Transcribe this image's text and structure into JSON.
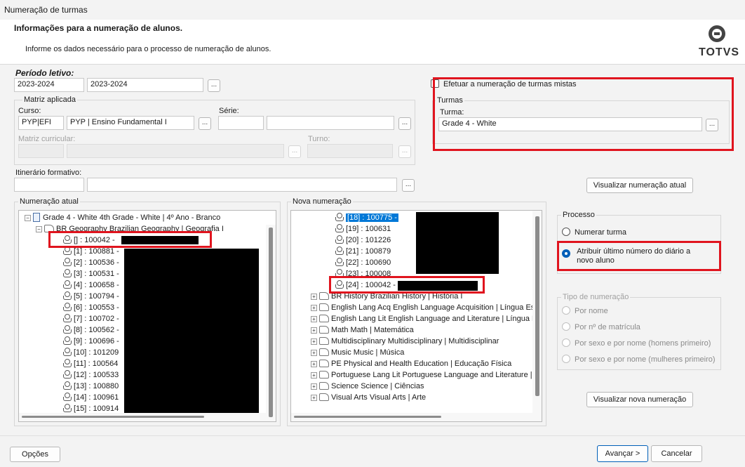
{
  "window": {
    "title": "Numeração de turmas"
  },
  "header": {
    "title": "Informações para a numeração de alunos.",
    "description": "Informe os dados necessário para o processo de numeração de alunos.",
    "logo_text": "TOTVS"
  },
  "periodo": {
    "label": "Período letivo:",
    "code": "2023-2024",
    "name": "2023-2024"
  },
  "matriz": {
    "group_title": "Matriz aplicada",
    "curso_label": "Curso:",
    "curso_code": "PYP|EFI",
    "curso_name": "PYP | Ensino Fundamental I",
    "serie_label": "Série:",
    "serie_code": "",
    "serie_name": "",
    "matriz_label": "Matriz curricular:",
    "turno_label": "Turno:"
  },
  "itinerario": {
    "label": "Itinerário formativo:",
    "code": "",
    "name": ""
  },
  "mistas": {
    "label": "Efetuar a numeração de turmas mistas",
    "checked": false
  },
  "turmas": {
    "group_title": "Turmas",
    "turma_label": "Turma:",
    "turma_value": "Grade 4 - White"
  },
  "buttons": {
    "visualizar_atual": "Visualizar numeração atual",
    "visualizar_nova": "Visualizar nova numeração",
    "opcoes": "Opções",
    "avancar": "Avançar >",
    "cancelar": "Cancelar",
    "lookup": "..."
  },
  "numeracao_atual": {
    "title": "Numeração atual",
    "root": "Grade 4 - White  4th Grade - White | 4º Ano - Branco",
    "subject": "BR Geography  Brazilian Geography | Geografia I",
    "first": "[] : 100042 -",
    "students": [
      "[1] : 100881 -",
      "[2] : 100536 -",
      "[3] : 100531 -",
      "[4] : 100658 -",
      "[5] : 100794 -",
      "[6] : 100553 -",
      "[7] : 100702 -",
      "[8] : 100562 -",
      "[9] : 100696 -",
      "[10] : 101209",
      "[11] : 100564",
      "[12] : 100533",
      "[13] : 100880",
      "[14] : 100961",
      "[15] : 100914"
    ]
  },
  "nova_numeracao": {
    "title": "Nova numeração",
    "selected": "[18] : 100775 -",
    "students": [
      "[19] : 100631",
      "[20] : 101226",
      "[21] : 100879",
      "[22] : 100690",
      "[23] : 100008"
    ],
    "last": "[24] : 100042 -",
    "subjects": [
      "BR History  Brazilian History | História I",
      "English Lang Acq  English Language Acquisition | Língua Estr",
      "English Lang Lit  English Language and Literature | Língua Es",
      "Math  Math | Matemática",
      "Multidisciplinary  Multidisciplinary | Multidisciplinar",
      "Music  Music | Música",
      "PE  Physical and Health Education | Educação Física",
      "Portuguese Lang Lit  Portuguese Language and Literature |",
      "Science  Science | Ciências",
      "Visual Arts  Visual Arts | Arte"
    ]
  },
  "processo": {
    "title": "Processo",
    "options": [
      "Numerar turma",
      "Atribuir último número do diário a novo aluno"
    ],
    "selected_index": 1
  },
  "tipo": {
    "title": "Tipo de numeração",
    "options": [
      "Por nome",
      "Por nº de matrícula",
      "Por sexo e por nome (homens primeiro)",
      "Por sexo e por nome (mulheres primeiro)"
    ]
  },
  "colors": {
    "highlight": "#e0141e",
    "selection": "#0078d7"
  }
}
